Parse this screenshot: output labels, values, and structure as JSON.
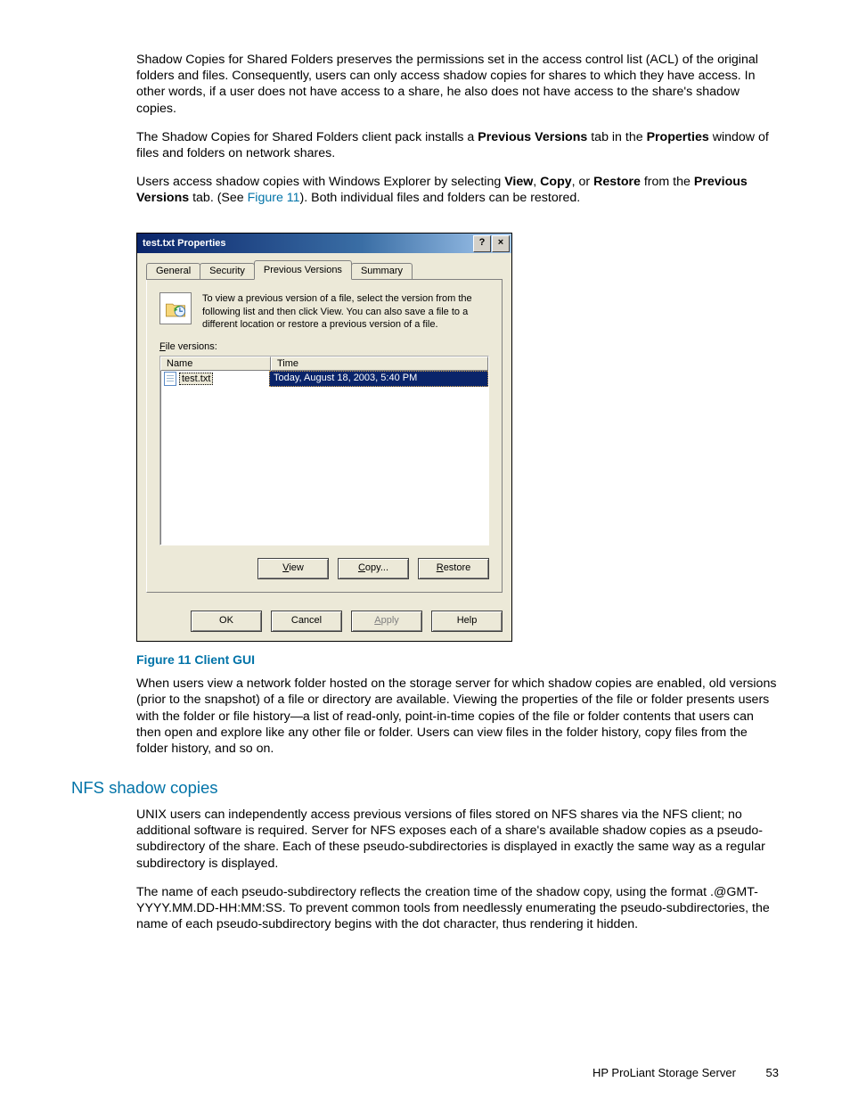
{
  "page": {
    "p1_a": "Shadow Copies for Shared Folders preserves the permissions set in the access control list (ACL) of the original folders and files. Consequently, users can only access shadow copies for shares to which they have access. In other words, if a user does not have access to a share, he also does not have access to the share's shadow copies.",
    "p2_a": "The Shadow Copies for Shared Folders client pack installs a ",
    "p2_b_bold": "Previous Versions",
    "p2_c": " tab in the ",
    "p2_d_bold": "Properties",
    "p2_e": " window of files and folders on network shares.",
    "p3_a": "Users access shadow copies with Windows Explorer by selecting ",
    "p3_b_bold": "View",
    "p3_c": ", ",
    "p3_d_bold": "Copy",
    "p3_e": ", or ",
    "p3_f_bold": "Restore",
    "p3_g": " from the ",
    "p3_h_bold": "Previous Versions",
    "p3_i": " tab. (See ",
    "p3_link": "Figure 11",
    "p3_j": "). Both individual files and folders can be restored.",
    "fig_caption": "Figure 11 Client GUI",
    "p4": "When users view a network folder hosted on the storage server for which shadow copies are enabled, old versions (prior to the snapshot) of a file or directory are available. Viewing the properties of the file or folder presents users with the folder or file history—a list of read-only, point-in-time copies of the file or folder contents that users can then open and explore like any other file or folder. Users can view files in the folder history, copy files from the folder history, and so on.",
    "section_h": "NFS shadow copies",
    "p5": "UNIX users can independently access previous versions of files stored on NFS shares via the NFS client; no additional software is required. Server for NFS exposes each of a share's available shadow copies as a pseudo-subdirectory of the share. Each of these pseudo-subdirectories is displayed in exactly the same way as a regular subdirectory is displayed.",
    "p6": "The name of each pseudo-subdirectory reflects the creation time of the shadow copy, using the format .@GMT-YYYY.MM.DD-HH:MM:SS. To prevent common tools from needlessly enumerating the pseudo-subdirectories, the name of each pseudo-subdirectory begins with the dot character, thus rendering it hidden.",
    "footer_label": "HP ProLiant Storage Server",
    "footer_page": "53"
  },
  "dialog": {
    "title": "test.txt Properties",
    "help_glyph": "?",
    "close_glyph": "×",
    "tabs": {
      "general": "General",
      "security": "Security",
      "previous": "Previous Versions",
      "summary": "Summary"
    },
    "info_text": "To view a previous version of a file, select the version from the following list and then click View.  You can also save a file to a different location or restore a previous version of a file.",
    "file_versions_prefix": "F",
    "file_versions_rest": "ile versions:",
    "columns": {
      "name": "Name",
      "time": "Time"
    },
    "rows": [
      {
        "name": "test.txt",
        "time": "Today, August 18, 2003, 5:40 PM"
      }
    ],
    "buttons": {
      "view_u": "V",
      "view_rest": "iew",
      "copy_u": "C",
      "copy_rest": "opy...",
      "restore_u": "R",
      "restore_rest": "estore",
      "ok": "OK",
      "cancel": "Cancel",
      "apply_u": "A",
      "apply_rest": "pply",
      "help": "Help"
    }
  }
}
